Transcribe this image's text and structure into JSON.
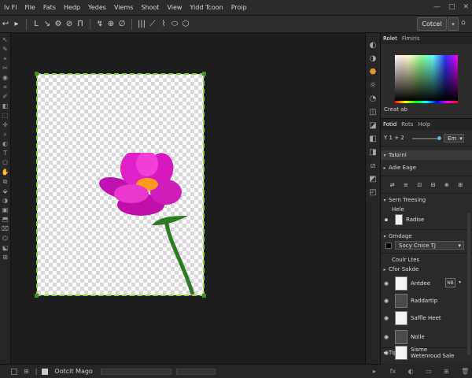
{
  "menubar": {
    "items": [
      "Iv Fl",
      "File",
      "Fats",
      "Hedp",
      "Yedes",
      "Viems",
      "Shoot",
      "View",
      "Yidd Tcoon",
      "Proip"
    ],
    "window_controls": [
      "—",
      "□",
      "✕"
    ]
  },
  "optionsbar": {
    "cancel_label": "Cotcel",
    "cancel_dropdown_icon": "▾",
    "tools": [
      "↩",
      "▸",
      "L",
      "↘",
      "⚙",
      "⊘",
      "Π",
      "↯",
      "⊕",
      "∅",
      "|||",
      "⟋",
      "⌇",
      "⬭",
      "⬡"
    ]
  },
  "toolbox": {
    "tools": [
      "↖",
      "✎",
      "⌖",
      "✂",
      "◉",
      "⌗",
      "✐",
      "◧",
      "⬚",
      "✛",
      "⌕",
      "◐",
      "T",
      "⬠",
      "✋",
      "⧉",
      "⬙",
      "◑",
      "▣",
      "⬒",
      "⌧",
      "⌬",
      "⬕",
      "⊞"
    ]
  },
  "canvas": {
    "flower_petal_color": "#e020c8",
    "flower_center_color": "#ff9a1a",
    "stem_color": "#2f7a25",
    "selection_color": "#8fd43a"
  },
  "statusbar": {
    "doc_label": "Ootcit Mago"
  },
  "iconstrip": {
    "icons": [
      "◐",
      "◑",
      "⬣",
      "☼",
      "◔",
      "◫",
      "◪",
      "◧",
      "◨",
      "⧄",
      "◩",
      "◰"
    ]
  },
  "color_panel": {
    "tabs": [
      "Rolet",
      "Fimiris"
    ],
    "swatch_label": "Creat ab"
  },
  "props_panel": {
    "tabs": [
      "Fotid",
      "Rots",
      "Holp"
    ],
    "value_row": {
      "label": "Y 1 + 2",
      "field": "Em",
      "field_arrow": "▾"
    },
    "sections": {
      "tutorial": "Talornl",
      "adjust": "Adie Eage",
      "tool_row": [
        "⇄",
        "≡",
        "⊡",
        "⊟",
        "⊕",
        "⊞"
      ],
      "save_trees": "Sern Treesing",
      "hue": "Hele",
      "radius": "Radise",
      "grading": "Gmdage",
      "stroke_dropdown": "Socy Cnice TJ",
      "course": "Coulr Ltes",
      "cfor_shade": "Cfor Sakde"
    },
    "layers": [
      {
        "name": "Antdee",
        "badge": "NB",
        "dark": false
      },
      {
        "name": "Raddartip",
        "badge": "",
        "dark": true
      },
      {
        "name": "Saffle Heet",
        "badge": "",
        "dark": false
      },
      {
        "name": "Nolle",
        "badge": "",
        "dark": true
      }
    ],
    "tiplip": "Tiplip",
    "bottom_layer": "Sisme Wetenroud Sale",
    "footer_icons": [
      "fx",
      "◐",
      "▭",
      "⊞",
      "🗑"
    ]
  }
}
